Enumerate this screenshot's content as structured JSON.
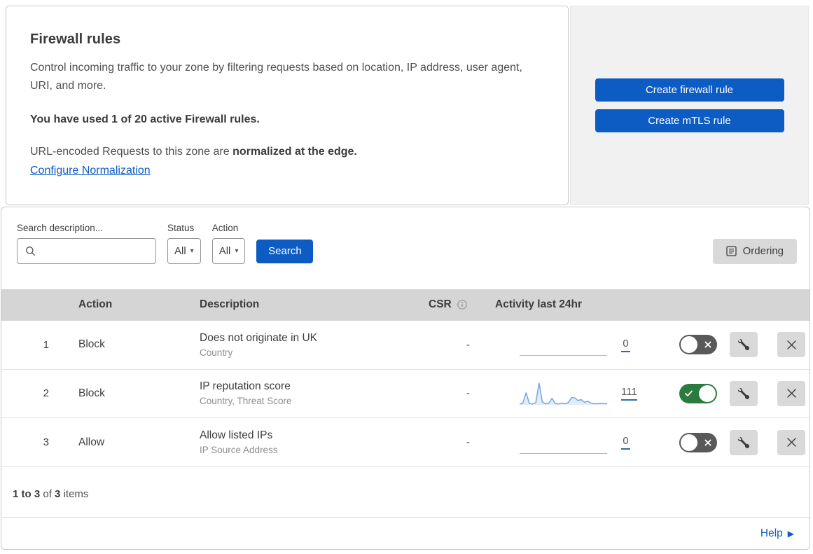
{
  "header": {
    "title": "Firewall rules",
    "description": "Control incoming traffic to your zone by filtering requests based on location, IP address, user agent, URI, and more.",
    "usage": "You have used 1 of 20 active Firewall rules.",
    "normalization_prefix": "URL-encoded Requests to this zone are ",
    "normalization_bold": "normalized at the edge.",
    "normalization_link": "Configure Normalization"
  },
  "actions_panel": {
    "create_firewall_label": "Create firewall rule",
    "create_mtls_label": "Create mTLS rule"
  },
  "filters": {
    "search_label": "Search description...",
    "search_value": "",
    "status_label": "Status",
    "status_value": "All",
    "action_label": "Action",
    "action_value": "All",
    "search_button_label": "Search",
    "ordering_button_label": "Ordering"
  },
  "table": {
    "columns": {
      "action": "Action",
      "description": "Description",
      "csr": "CSR",
      "activity": "Activity last 24hr"
    },
    "rows": [
      {
        "priority": "1",
        "action": "Block",
        "description": "Does not originate in UK",
        "fields": "Country",
        "csr": "-",
        "activity_count": "0",
        "enabled": false
      },
      {
        "priority": "2",
        "action": "Block",
        "description": "IP reputation score",
        "fields": "Country, Threat Score",
        "csr": "-",
        "activity_count": "111",
        "enabled": true,
        "sparkline": [
          3,
          8,
          55,
          6,
          4,
          10,
          100,
          14,
          5,
          8,
          30,
          6,
          4,
          8,
          5,
          10,
          33,
          32,
          20,
          24,
          12,
          16,
          8,
          6,
          5,
          7,
          5,
          6
        ]
      },
      {
        "priority": "3",
        "action": "Allow",
        "description": "Allow listed IPs",
        "fields": "IP Source Address",
        "csr": "-",
        "activity_count": "0",
        "enabled": false
      }
    ]
  },
  "footer": {
    "range_bold": "1 to 3",
    "of_text": "of",
    "total_bold": "3",
    "items_text": "items",
    "help_label": "Help"
  },
  "colors": {
    "accent_blue": "#0d5cc4",
    "toggle_on_green": "#2b7b3e",
    "toggle_off_gray": "#595959",
    "sparkline_blue": "#74a7e0",
    "table_header_gray": "#d5d5d5",
    "panel_gray": "#f1f1f1"
  },
  "icons": {
    "search": "magnifier",
    "ordering": "list-page",
    "csr_info": "info-circle",
    "edit": "wrench",
    "delete": "x",
    "toggle_on": "check",
    "toggle_off": "x",
    "help_arrow": "triangle-right",
    "select_caret": "chevron-down"
  }
}
